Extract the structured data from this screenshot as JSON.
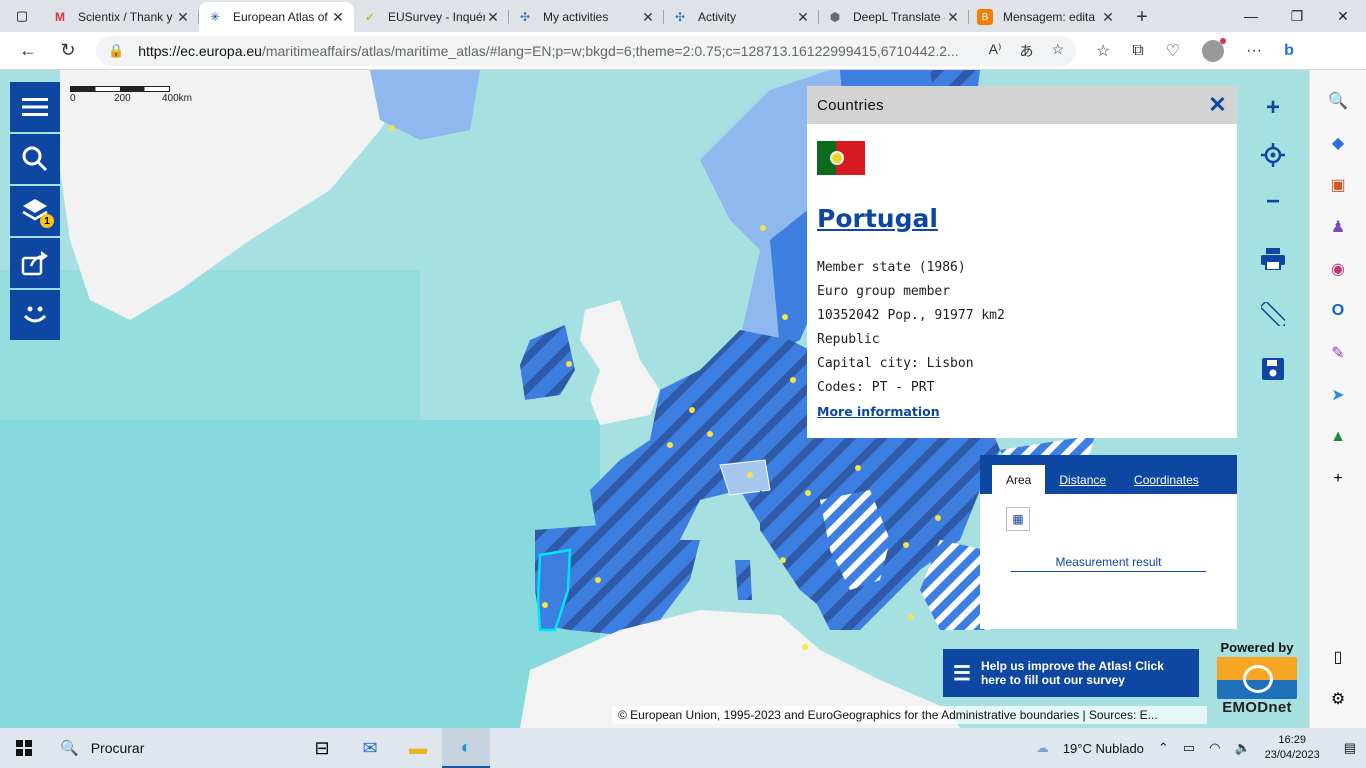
{
  "browser": {
    "tabs": [
      {
        "label": "Scientix / Thank y",
        "icon": "gmail-icon",
        "active": false
      },
      {
        "label": "European Atlas of",
        "icon": "atlas-icon",
        "active": true
      },
      {
        "label": "EUSurvey - Inquér",
        "icon": "eusurvey-icon",
        "active": false
      },
      {
        "label": "My activities",
        "icon": "activities-icon",
        "active": false
      },
      {
        "label": "Activity",
        "icon": "activity-icon",
        "active": false
      },
      {
        "label": "DeepL Translate -",
        "icon": "deepl-icon",
        "active": false
      },
      {
        "label": "Mensagem: edita",
        "icon": "blogger-icon",
        "active": false
      }
    ],
    "url_host": "https://ec.europa.eu",
    "url_path": "/maritimeaffairs/atlas/maritime_atlas/#lang=EN;p=w;bkgd=6;theme=2:0.75;c=128713.16122999415,6710442.2..."
  },
  "map": {
    "scale": {
      "labels": [
        "0",
        "200",
        "400km"
      ]
    },
    "left_toolbar": [
      "menu-icon",
      "search-icon",
      "layers-icon",
      "share-icon",
      "feedback-icon"
    ],
    "layers_badge": "1",
    "right_toolbar": [
      "zoom-in-icon",
      "locate-icon",
      "zoom-out-icon",
      "print-icon",
      "ruler-icon",
      "save-icon"
    ]
  },
  "popup": {
    "title": "Countries",
    "country": "Portugal",
    "lines": [
      "Member state (1986)",
      "Euro group member",
      "10352042 Pop., 91977 km2",
      "Republic",
      "Capital city: Lisbon",
      "Codes: PT - PRT"
    ],
    "more": "More information"
  },
  "measure": {
    "tabs": [
      "Area",
      "Distance",
      "Coordinates"
    ],
    "result": "Measurement result"
  },
  "survey": "Help us improve the Atlas! Click here to fill out our survey",
  "emodnet": {
    "powered": "Powered by",
    "name": "EMODnet"
  },
  "attribution": "© European Union, 1995-2023 and EuroGeographics for the Administrative boundaries | Sources: E...",
  "taskbar": {
    "search": "Procurar",
    "weather": "19°C  Nublado",
    "time": "16:29",
    "date": "23/04/2023"
  },
  "colors": {
    "accent": "#0e47a1",
    "land_eu": "#3d7fe0",
    "sea": "#9fdfe0",
    "highlight": "#00e5ff"
  }
}
